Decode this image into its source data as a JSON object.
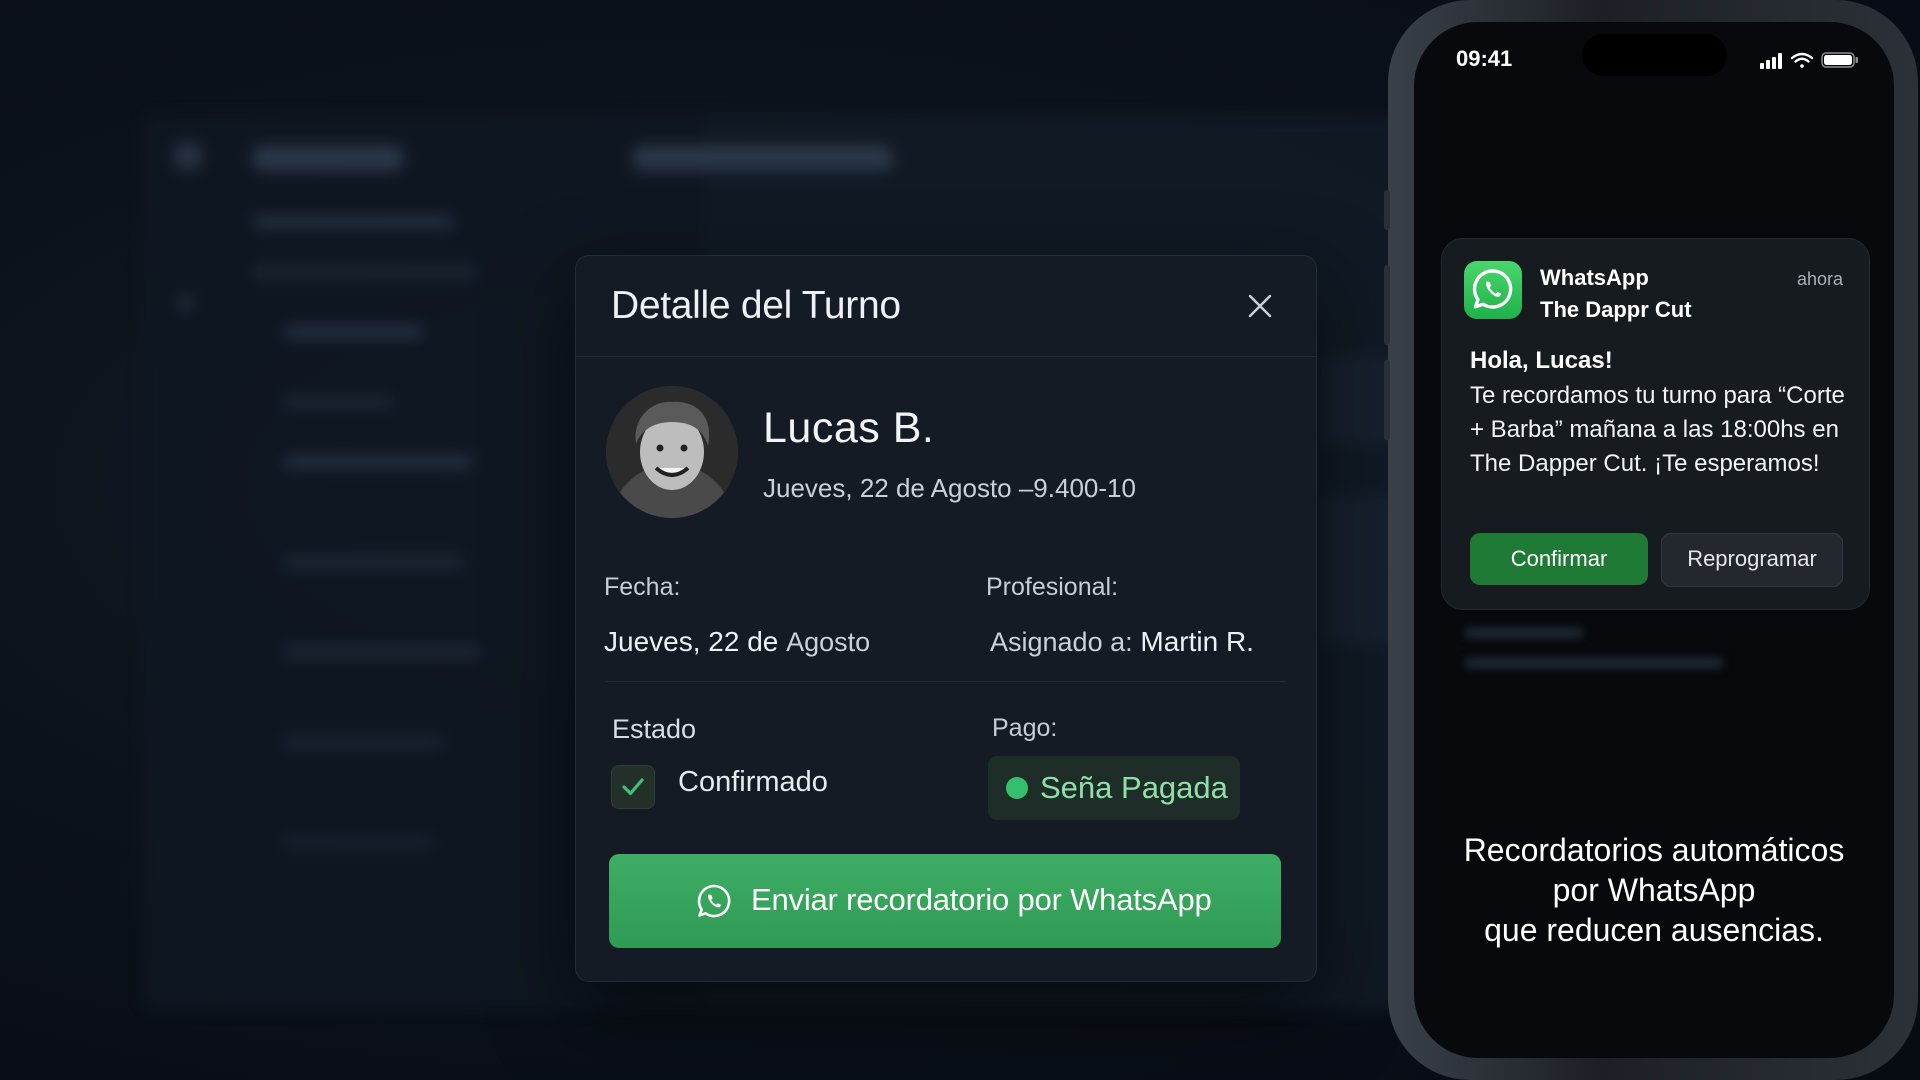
{
  "modal": {
    "title": "Detalle del Turno",
    "client_name": "Lucas B.",
    "client_subtitle": "Jueves, 22 de Agosto –9.400-10",
    "fecha_label": "Fecha:",
    "fecha_value_main": "Jueves, 22 de",
    "fecha_value_month": "Agosto",
    "profesional_label": "Profesional:",
    "profesional_prefix": "Asignado a:",
    "profesional_name": "Martin R.",
    "estado_label": "Estado",
    "estado_value": "Confirmado",
    "pago_label": "Pago:",
    "pago_value": "Seña Pagada",
    "whatsapp_button": "Enviar recordatorio por WhatsApp"
  },
  "phone": {
    "time": "09:41",
    "notification": {
      "app": "WhatsApp",
      "sender": "The Dappr Cut",
      "time": "ahora",
      "greeting": "Hola, Lucas!",
      "body": "Te recordamos tu turno para “Corte + Barba” mañana a las 18:00hs en The Dapper Cut. ¡Te esperamos!",
      "confirm": "Confirmar",
      "reschedule": "Reprogramar"
    },
    "tagline": {
      "line1": "Recordatorios automáticos",
      "line2": "por WhatsApp",
      "line3": "que reducen ausencias."
    }
  },
  "colors": {
    "accent_green": "#34c06a",
    "button_green": "#3fae65",
    "confirm_green": "#1e7a35",
    "modal_bg": "#141b24"
  },
  "icons": [
    "close-icon",
    "check-icon",
    "whatsapp-icon",
    "signal-icon",
    "wifi-icon",
    "battery-icon"
  ]
}
